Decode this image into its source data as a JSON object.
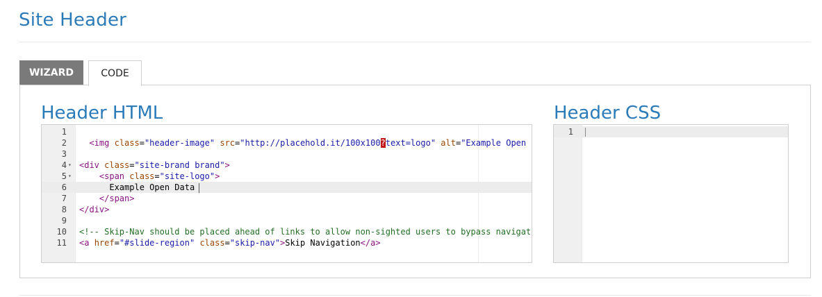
{
  "page": {
    "title": "Site Header"
  },
  "tabs": [
    {
      "label": "WIZARD",
      "active": false
    },
    {
      "label": "CODE",
      "active": true
    }
  ],
  "html_editor": {
    "heading": "Header HTML",
    "lines": [
      {
        "n": "1",
        "fold": "",
        "text": ""
      },
      {
        "n": "2",
        "fold": "",
        "text": "  <img class=\"header-image\" src=\"http://placehold.it/100x100?text=logo\" alt=\"Example Open D"
      },
      {
        "n": "3",
        "fold": "",
        "text": ""
      },
      {
        "n": "4",
        "fold": "▾",
        "text": "<div class=\"site-brand brand\">"
      },
      {
        "n": "5",
        "fold": "▾",
        "text": "    <span class=\"site-logo\">"
      },
      {
        "n": "6",
        "fold": "",
        "text": "      Example Open Data"
      },
      {
        "n": "7",
        "fold": "",
        "text": "    </span>"
      },
      {
        "n": "8",
        "fold": "",
        "text": "</div>"
      },
      {
        "n": "9",
        "fold": "",
        "text": ""
      },
      {
        "n": "10",
        "fold": "",
        "text": "<!-- Skip-Nav should be placed ahead of links to allow non-sighted users to bypass navigati"
      },
      {
        "n": "11",
        "fold": "",
        "text": "<a href=\"#slide-region\" class=\"skip-nav\">Skip Navigation</a>"
      }
    ],
    "active_line": "6"
  },
  "css_editor": {
    "heading": "Header CSS",
    "lines": [
      {
        "n": "1",
        "text": ""
      }
    ]
  },
  "colors": {
    "heading_blue": "#2b7bb9",
    "tag": "#881280",
    "attr": "#994500",
    "value": "#1a1aa6",
    "comment": "#236e25"
  }
}
